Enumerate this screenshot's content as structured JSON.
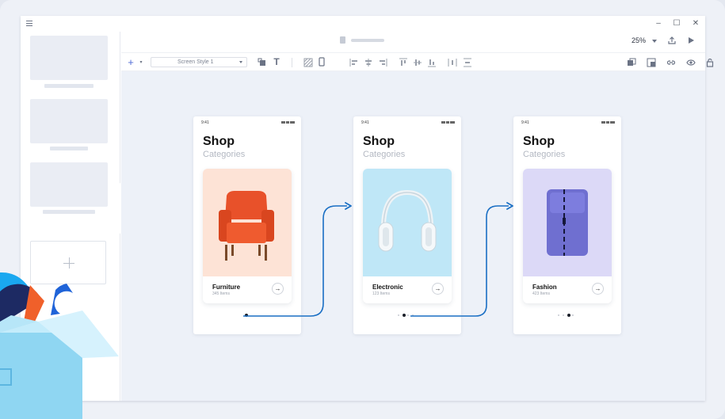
{
  "window": {
    "controls": {
      "minimize": "–",
      "maximize": "☐",
      "close": "✕"
    }
  },
  "topbar": {
    "zoom": "25%",
    "icons": [
      "document-icon",
      "share-icon",
      "play-icon"
    ]
  },
  "toolbar": {
    "add_icon": "+",
    "style_select": "Screen Style 1",
    "icons": [
      "layers-icon",
      "text-icon",
      "pattern-icon",
      "device-icon",
      "align-left-icon",
      "align-center-icon",
      "align-right-icon",
      "align-top-icon",
      "align-middle-icon",
      "align-bottom-icon",
      "distribute-h-icon",
      "distribute-v-icon",
      "copy-icon",
      "crop-icon",
      "link-icon",
      "eye-icon",
      "lock-icon"
    ]
  },
  "screens": [
    {
      "status_time": "9:41",
      "title": "Shop",
      "subtitle": "Categories",
      "category": "Furniture",
      "count": "345 Items",
      "arrow": "→",
      "image": "armchair",
      "bg": "#fde3d6"
    },
    {
      "status_time": "9:41",
      "title": "Shop",
      "subtitle": "Categories",
      "category": "Electronic",
      "count": "123 Items",
      "arrow": "→",
      "image": "headphones",
      "bg": "#bfe7f7"
    },
    {
      "status_time": "9:41",
      "title": "Shop",
      "subtitle": "Categories",
      "category": "Fashion",
      "count": "423 Items",
      "arrow": "→",
      "image": "backpack",
      "bg": "#dcd9f7"
    }
  ],
  "colors": {
    "flow_line": "#1a6fc4",
    "canvas": "#edf1f8"
  }
}
